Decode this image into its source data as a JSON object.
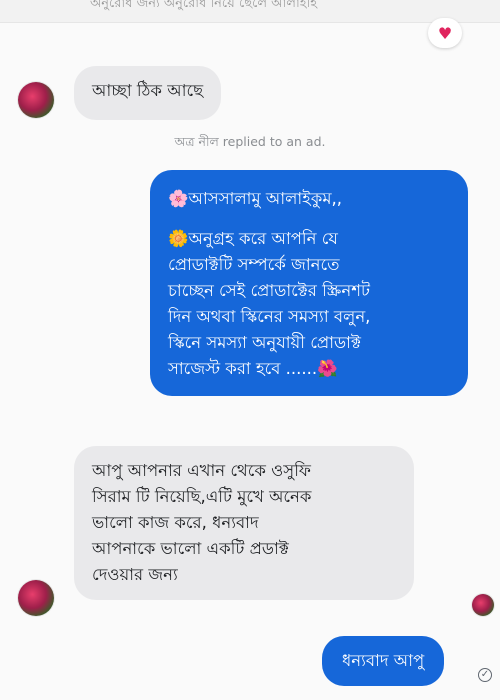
{
  "thread": {
    "previous_partial_text": "অনুরোধ জন্য অনুরোধ নিয়ে ছেলে আলাইহি",
    "reaction_icon": "heart-icon",
    "system_note": "অত্র নীল replied to an ad.",
    "messages": [
      {
        "sender": "customer",
        "lines": [
          "আচ্ছা ঠিক আছে"
        ]
      },
      {
        "sender": "page",
        "lines": [
          "🌸আসসালামু আলাইকুম,,",
          "",
          "🌼অনুগ্রহ করে আপনি যে",
          "প্রোডাক্টটি সম্পর্কে জানতে",
          "চাচ্ছেন সেই প্রোডাক্টের স্ক্রিনশট",
          "দিন অথবা স্কিনের সমস্যা বলুন,",
          "স্কিনে সমস্যা অনুযায়ী প্রোডাক্ট",
          "সাজেস্ট করা হবে  ......🌺"
        ]
      },
      {
        "sender": "customer",
        "lines": [
          "আপু আপনার এখান থেকে ওসুফি",
          "সিরাম টি নিয়েছি,এটি মুখে অনেক",
          "ভালো কাজ করে, ধন্যবাদ",
          "আপনাকে ভালো একটি প্রডাক্ট",
          "দেওয়ার জন্য"
        ]
      },
      {
        "sender": "page",
        "lines": [
          "ধন্যবাদ আপু"
        ]
      }
    ],
    "colors": {
      "outgoing_bubble": "#1667d9",
      "incoming_bubble": "#e9e9eb"
    }
  }
}
